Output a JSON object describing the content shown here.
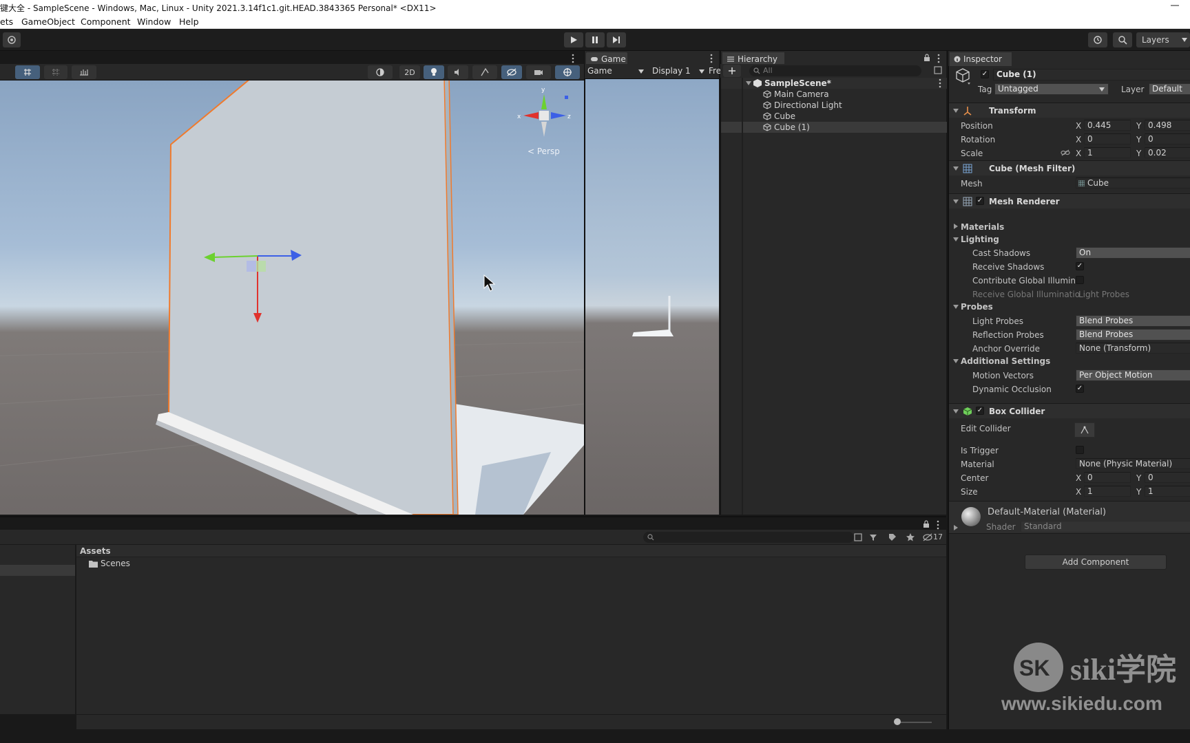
{
  "window": {
    "title": "键大全 - SampleScene - Windows, Mac, Linux - Unity 2021.3.14f1c1.git.HEAD.3843365 Personal* <DX11>"
  },
  "menu": {
    "items": [
      "ets",
      "GameObject",
      "Component",
      "Window",
      "Help"
    ]
  },
  "toolbar": {
    "layers_label": "Layers"
  },
  "scene": {
    "mode_2d": "2D",
    "gizmo_persp": "< Persp",
    "gizmo_x": "x",
    "gizmo_y": "y",
    "gizmo_z": "z"
  },
  "game": {
    "tab": "Game",
    "view_dropdown": "Game",
    "display_dropdown": "Display 1",
    "aspect_partial": "Fre"
  },
  "hierarchy": {
    "tab": "Hierarchy",
    "search_placeholder": "All",
    "scene_name": "SampleScene*",
    "items": [
      "Main Camera",
      "Directional Light",
      "Cube",
      "Cube (1)"
    ]
  },
  "inspector": {
    "tab": "Inspector",
    "object_name": "Cube (1)",
    "tag_label": "Tag",
    "tag_value": "Untagged",
    "layer_label": "Layer",
    "layer_value": "Default",
    "transform": {
      "title": "Transform",
      "position_label": "Position",
      "rotation_label": "Rotation",
      "scale_label": "Scale",
      "position": {
        "x": "0.445",
        "y": "0.498"
      },
      "rotation": {
        "x": "0",
        "y": "0"
      },
      "scale": {
        "x": "1",
        "y": "0.02"
      }
    },
    "mesh_filter": {
      "title": "Cube (Mesh Filter)",
      "mesh_label": "Mesh",
      "mesh_value": "Cube"
    },
    "mesh_renderer": {
      "title": "Mesh Renderer",
      "materials": "Materials",
      "lighting": "Lighting",
      "cast_shadows_label": "Cast Shadows",
      "cast_shadows_value": "On",
      "receive_shadows_label": "Receive Shadows",
      "contribute_gi_label": "Contribute Global Illuminat",
      "receive_gi_label": "Receive Global Illuminatio",
      "receive_gi_value": "Light Probes",
      "probes": "Probes",
      "light_probes_label": "Light Probes",
      "light_probes_value": "Blend Probes",
      "reflection_probes_label": "Reflection Probes",
      "reflection_probes_value": "Blend Probes",
      "anchor_override_label": "Anchor Override",
      "anchor_override_value": "None (Transform)",
      "additional_settings": "Additional Settings",
      "motion_vectors_label": "Motion Vectors",
      "motion_vectors_value": "Per Object Motion",
      "dynamic_occlusion_label": "Dynamic Occlusion"
    },
    "box_collider": {
      "title": "Box Collider",
      "edit_collider_label": "Edit Collider",
      "is_trigger_label": "Is Trigger",
      "material_label": "Material",
      "material_value": "None (Physic Material)",
      "center_label": "Center",
      "center": {
        "x": "0",
        "y": "0"
      },
      "size_label": "Size",
      "size": {
        "x": "1",
        "y": "1"
      }
    },
    "material": {
      "name": "Default-Material (Material)",
      "shader_label": "Shader",
      "shader_value": "Standard"
    },
    "add_component": "Add Component",
    "axis_x": "X",
    "axis_y": "Y"
  },
  "project": {
    "assets_header": "Assets",
    "folders": [
      "Scenes"
    ],
    "hidden_count": "17"
  },
  "watermark": {
    "brand": "siki学院",
    "url": "www.sikiedu.com"
  },
  "colors": {
    "accent_blue": "#2c5d87",
    "selection_orange": "#f07a2c",
    "dark_bg": "#282828"
  }
}
